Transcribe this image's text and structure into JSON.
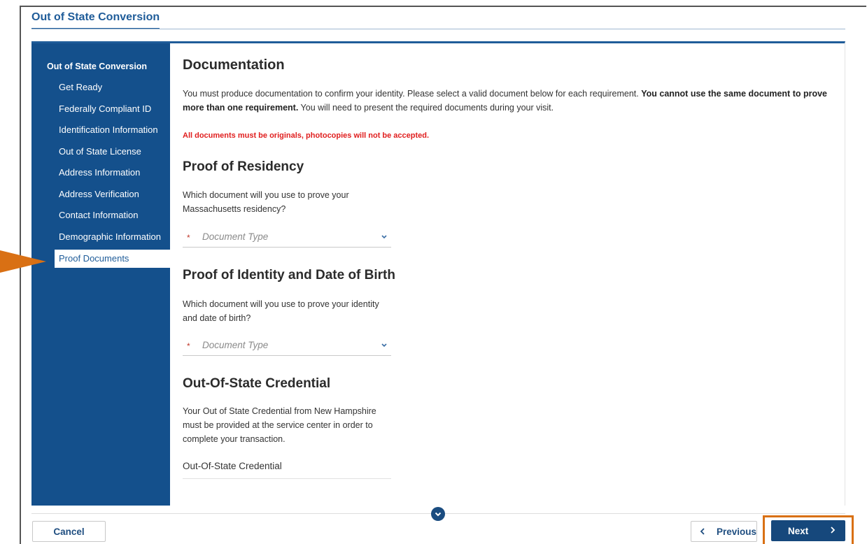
{
  "page": {
    "title": "Out of State Conversion"
  },
  "sidebar": {
    "heading": "Out of State Conversion",
    "items": [
      {
        "label": "Get Ready"
      },
      {
        "label": "Federally Compliant ID"
      },
      {
        "label": "Identification Information"
      },
      {
        "label": "Out of State License"
      },
      {
        "label": "Address Information"
      },
      {
        "label": "Address Verification"
      },
      {
        "label": "Contact Information"
      },
      {
        "label": "Demographic Information"
      },
      {
        "label": "Proof Documents",
        "active": true
      }
    ]
  },
  "main": {
    "heading": "Documentation",
    "intro_part1": "You must produce documentation to confirm your identity. Please select a valid document below for each requirement. ",
    "intro_bold": "You cannot use the same document to prove more than one requirement.",
    "intro_part2": " You will need to present the required documents during your visit.",
    "warning": "All documents must be originals, photocopies will not be accepted.",
    "residency": {
      "heading": "Proof of Residency",
      "question": "Which document will you use to prove your Massachusetts residency?",
      "required_mark": "*",
      "placeholder": "Document Type"
    },
    "identity": {
      "heading": "Proof of Identity and Date of Birth",
      "question": "Which document will you use to prove your identity and date of birth?",
      "required_mark": "*",
      "placeholder": "Document Type"
    },
    "credential": {
      "heading": "Out-Of-State Credential",
      "description": "Your Out of State Credential from New Hampshire must be provided at the service center in order to complete your transaction.",
      "field_value": "Out-Of-State Credential"
    }
  },
  "footer": {
    "cancel_label": "Cancel",
    "previous_label": "Previous",
    "next_label": "Next"
  },
  "colors": {
    "brand_blue": "#14508c",
    "highlight_orange": "#d97014",
    "warning_red": "#e01e1e"
  }
}
